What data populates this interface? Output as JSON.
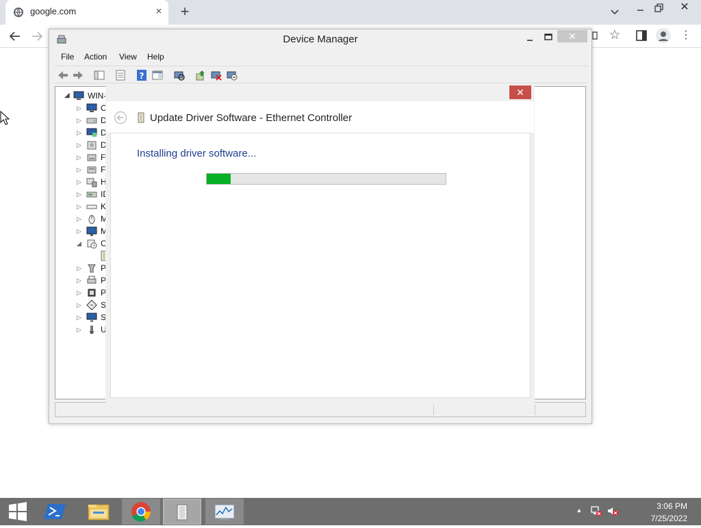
{
  "browser": {
    "tab_title": "google.com",
    "new_tab_label": "+",
    "tab_close": "×",
    "window_close": "✕",
    "star": "☆",
    "menu": "⋮"
  },
  "device_manager": {
    "title": "Device Manager",
    "close": "✕",
    "menu": [
      "File",
      "Action",
      "View",
      "Help"
    ],
    "toolbar_icons": [
      "back-arrow-icon",
      "forward-arrow-icon",
      "show-hide-console-tree-icon",
      "properties-icon",
      "help-icon",
      "action-pane-icon",
      "scan-hardware-icon",
      "update-driver-icon",
      "disable-device-icon",
      "uninstall-device-icon"
    ],
    "tree": {
      "root_label": "WIN-",
      "items": [
        {
          "label": "C",
          "expander": "▷",
          "icon": "computer-icon"
        },
        {
          "label": "D",
          "expander": "▷",
          "icon": "disk-drive-icon"
        },
        {
          "label": "D",
          "expander": "▷",
          "icon": "display-adapter-icon"
        },
        {
          "label": "D",
          "expander": "▷",
          "icon": "dvd-drive-icon"
        },
        {
          "label": "F",
          "expander": "▷",
          "icon": "floppy-icon"
        },
        {
          "label": "F",
          "expander": "▷",
          "icon": "floppy-controller-icon"
        },
        {
          "label": "H",
          "expander": "▷",
          "icon": "hid-icon"
        },
        {
          "label": "ID",
          "expander": "▷",
          "icon": "ide-controller-icon"
        },
        {
          "label": "K",
          "expander": "▷",
          "icon": "keyboard-icon"
        },
        {
          "label": "M",
          "expander": "▷",
          "icon": "mouse-icon"
        },
        {
          "label": "M",
          "expander": "▷",
          "icon": "monitor-icon"
        },
        {
          "label": "O",
          "expander": "◢",
          "icon": "other-devices-icon"
        },
        {
          "label": "",
          "expander": "",
          "icon": "ethernet-controller-icon"
        },
        {
          "label": "P",
          "expander": "▷",
          "icon": "ports-icon"
        },
        {
          "label": "P",
          "expander": "▷",
          "icon": "print-queue-icon"
        },
        {
          "label": "P",
          "expander": "▷",
          "icon": "processor-icon"
        },
        {
          "label": "S",
          "expander": "▷",
          "icon": "software-device-icon"
        },
        {
          "label": "S",
          "expander": "▷",
          "icon": "system-devices-icon"
        },
        {
          "label": "U",
          "expander": "▷",
          "icon": "usb-controller-icon"
        }
      ]
    }
  },
  "update_driver": {
    "title": "Update Driver Software - Ethernet Controller",
    "status": "Installing driver software...",
    "progress": 0.1,
    "close": "✕"
  },
  "taskbar": {
    "time": "3:06 PM",
    "date": "7/25/2022",
    "tray_up": "▲"
  },
  "colors": {
    "progress_green": "#06b025",
    "status_text_blue": "#1e3d8f",
    "dialog_close_red": "#c74f49",
    "taskbar": "#6e6e6e"
  }
}
